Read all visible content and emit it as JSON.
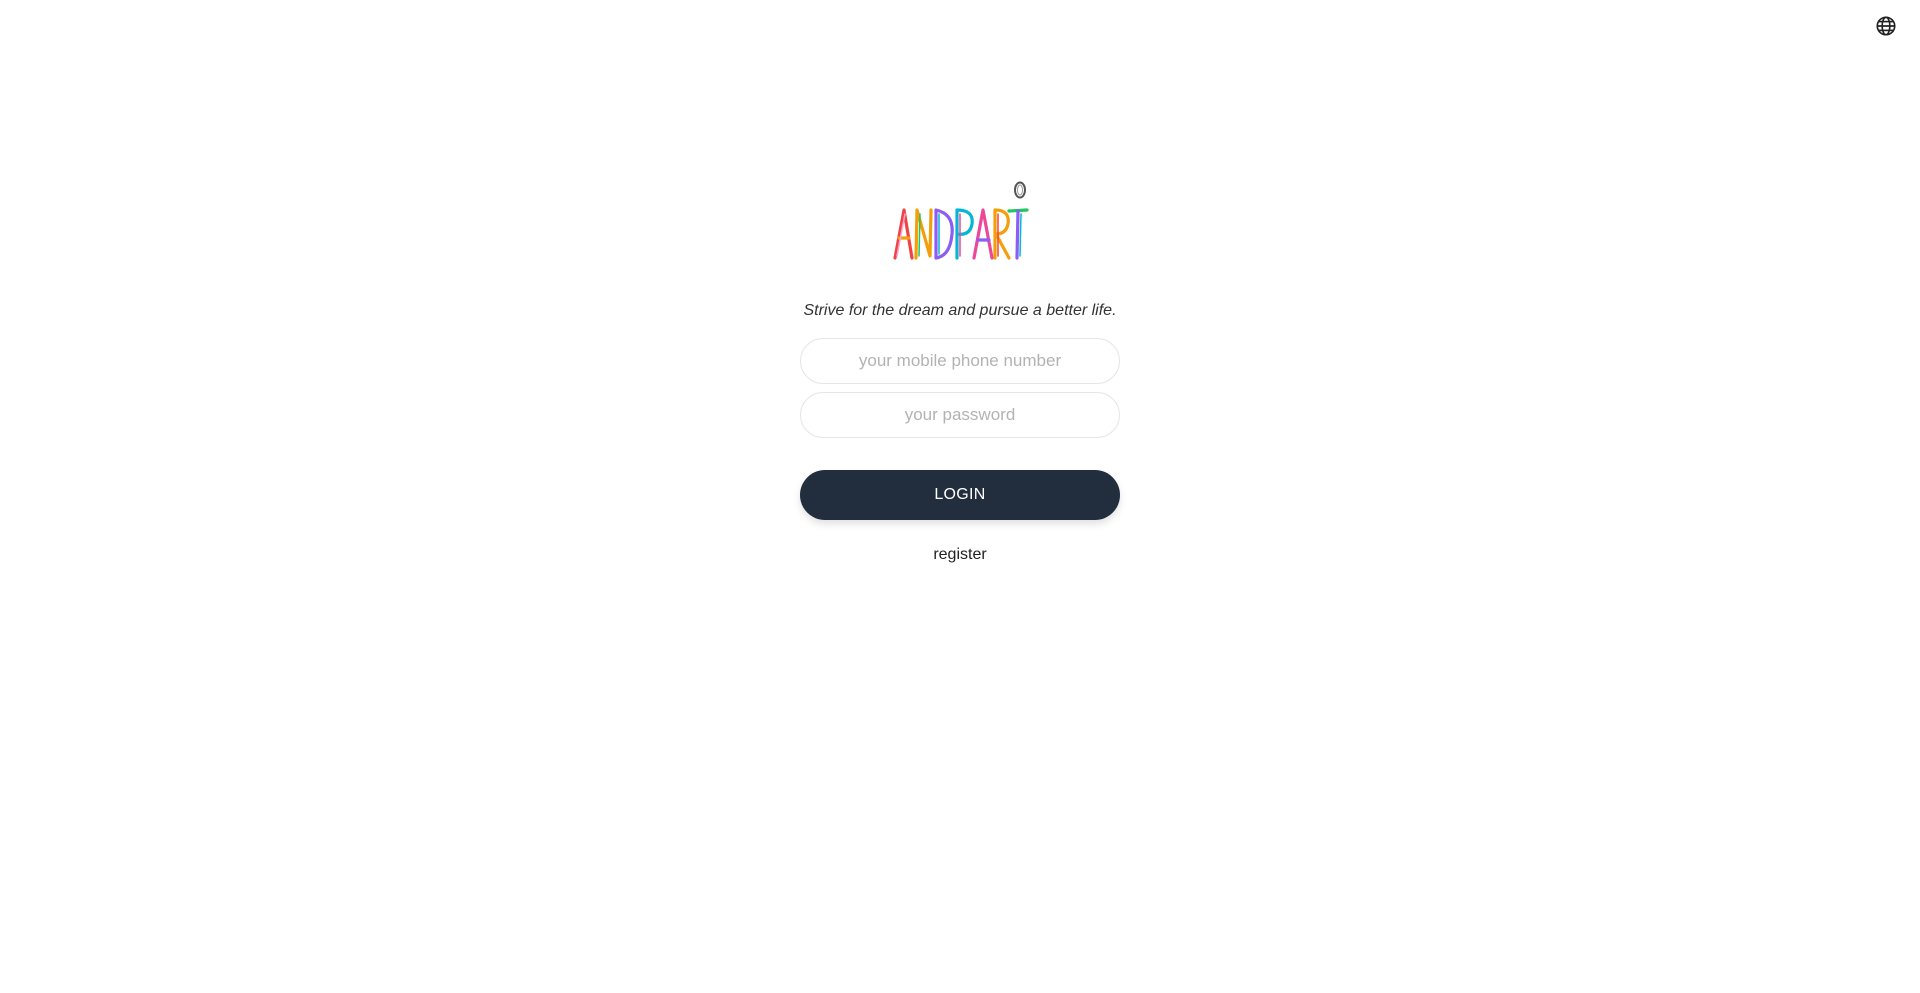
{
  "header": {
    "language_icon": "globe-icon"
  },
  "brand": {
    "logo_text": "ANDPART",
    "logo_icon": "brand-logo",
    "colors": [
      "#ef4444",
      "#f59e0b",
      "#8b5cf6",
      "#06b6d4",
      "#ec4899",
      "#22c55e"
    ]
  },
  "login": {
    "tagline": "Strive for the dream and pursue a better life.",
    "phone_placeholder": "your mobile phone number",
    "phone_value": "",
    "password_placeholder": "your password",
    "password_value": "",
    "login_label": "LOGIN",
    "register_label": "register"
  },
  "theme": {
    "button_color": "#222e3d",
    "background": "#ffffff"
  }
}
